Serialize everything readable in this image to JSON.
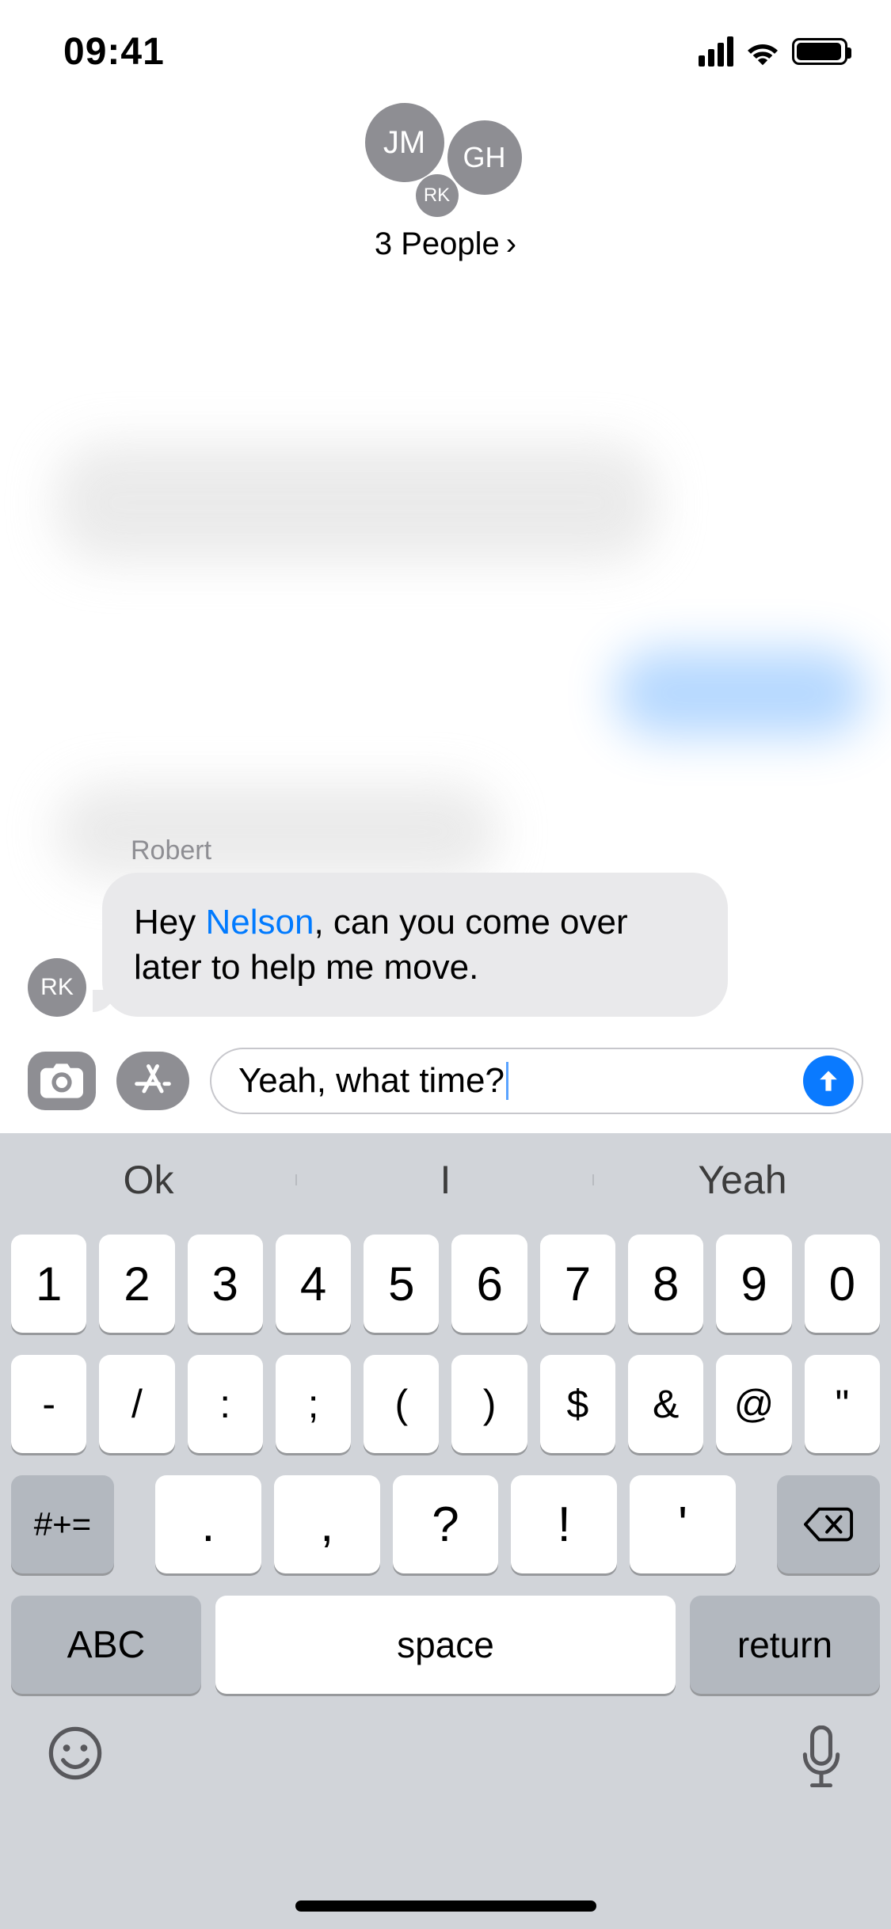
{
  "status": {
    "time": "09:41"
  },
  "header": {
    "avatars": {
      "a1": "JM",
      "a2": "GH",
      "a3": "RK"
    },
    "title": "3 People"
  },
  "message": {
    "sender": "Robert",
    "sender_initials": "RK",
    "text_pre": "Hey ",
    "mention": "Nelson",
    "text_post": ", can you come over later to help me move."
  },
  "compose": {
    "value": "Yeah, what time?"
  },
  "predictions": {
    "p1": "Ok",
    "p2": "I",
    "p3": "Yeah"
  },
  "keyboard": {
    "row1": [
      "1",
      "2",
      "3",
      "4",
      "5",
      "6",
      "7",
      "8",
      "9",
      "0"
    ],
    "row2": [
      "-",
      "/",
      ":",
      ";",
      "(",
      ")",
      "$",
      "&",
      "@",
      "\""
    ],
    "alt": "#+=",
    "row3": [
      ".",
      ",",
      "?",
      "!",
      "'"
    ],
    "abc": "ABC",
    "space": "space",
    "return": "return"
  }
}
